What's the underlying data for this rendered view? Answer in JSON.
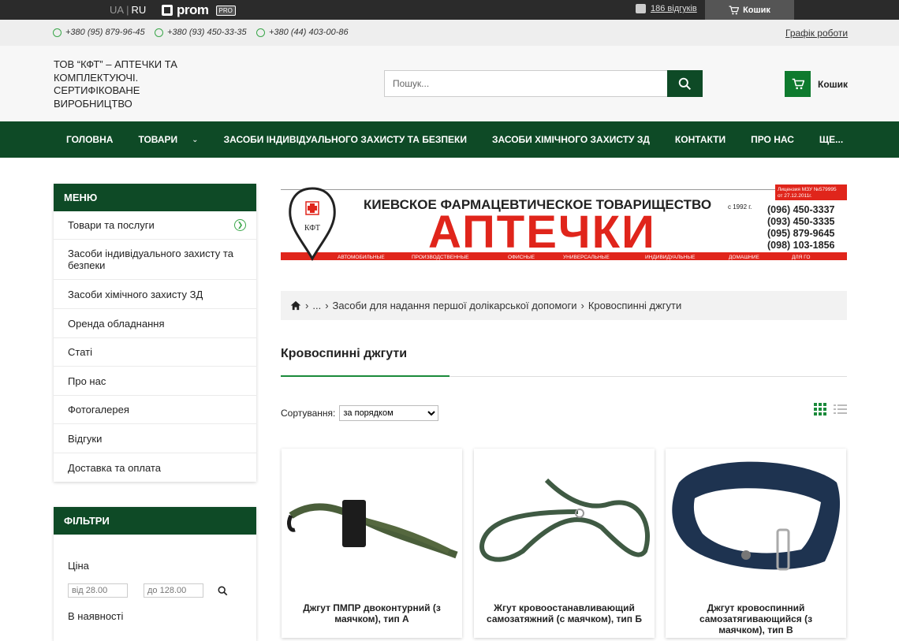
{
  "topbar": {
    "lang_ua": "UA",
    "lang_sep": "|",
    "lang_ru": "RU",
    "prom_logo": "prom",
    "prom_badge": "PRO",
    "reviews": "186 відгуків",
    "cart": "Кошик"
  },
  "contacts": {
    "phones": [
      "+380 (95) 879-96-45",
      "+380 (93) 450-33-35",
      "+380 (44) 403-00-86"
    ],
    "schedule": "Графік роботи"
  },
  "header": {
    "company": "ТОВ “КФТ” – АПТЕЧКИ ТА КОМПЛЕКТУЮЧІ. СЕРТИФІКОВАНЕ ВИРОБНИЦТВО",
    "search_placeholder": "Пошук...",
    "cart_label": "Кошик"
  },
  "nav": {
    "items": [
      "ГОЛОВНА",
      "ТОВАРИ",
      "ЗАСОБИ ІНДИВІДУАЛЬНОГО ЗАХИСТУ ТА БЕЗПЕКИ",
      "ЗАСОБИ ХІМІЧНОГО ЗАХИСТУ ЗД",
      "КОНТАКТИ",
      "ПРО НАС",
      "ЩЕ..."
    ]
  },
  "sidebar": {
    "menu_title": "МЕНЮ",
    "menu": [
      "Товари та послуги",
      "Засоби індивідуального захисту та безпеки",
      "Засоби хімічного захисту ЗД",
      "Оренда обладнання",
      "Статі",
      "Про нас",
      "Фотогалерея",
      "Відгуки",
      "Доставка та оплата"
    ],
    "filters_title": "ФІЛЬТРИ",
    "price_label": "Ціна",
    "price_from": "від 28.00",
    "price_to": "до 128.00",
    "availability_label": "В наявності"
  },
  "banner": {
    "line1": "КИЕВСКОЕ ФАРМАЦЕВТИЧЕСКОЕ ТОВАРИЩЕСТВО",
    "since": "с 1992 г.",
    "big": "АПТЕЧКИ",
    "license": "Лицензия МЗУ №579995",
    "license_date": "от 27.12.2011г.",
    "logo_text": "КФТ",
    "phones": [
      "(096) 450-3337",
      "(093) 450-3335",
      "(095) 879-9645",
      "(098) 103-1856"
    ],
    "categories": [
      "АВТОМОБИЛЬНЫЕ",
      "ПРОИЗВОДСТВЕННЫЕ",
      "ОФИСНЫЕ",
      "УНИВЕРСАЛЬНЫЕ",
      "ИНДИВИДУАЛЬНЫЕ",
      "ДОМАШНИЕ",
      "ДЛЯ ГО"
    ]
  },
  "breadcrumb": {
    "ellipsis": "...",
    "parent": "Засоби для надання першої долікарської допомоги",
    "current": "Кровоспинні джгути",
    "sep": "›"
  },
  "main": {
    "title": "Кровоспинні джгути",
    "sort_label": "Сортування:",
    "sort_value": "за порядком"
  },
  "products": [
    {
      "name": "Джгут ПМПР двоконтурний (з маячком), тип А"
    },
    {
      "name": "Жгут кровоостанавливающий самозатяжний (с маячком), тип Б"
    },
    {
      "name": "Джгут кровоспинний самозатягивающийся (з маячком), тип В"
    }
  ],
  "colors": {
    "nav_green": "#0e4a26",
    "accent_green": "#1a8a3a",
    "banner_red": "#e0251b"
  },
  "icons": [
    "search-icon",
    "cart-icon",
    "home-icon",
    "phone-icon",
    "grid-view-icon",
    "list-view-icon",
    "chat-icon"
  ]
}
